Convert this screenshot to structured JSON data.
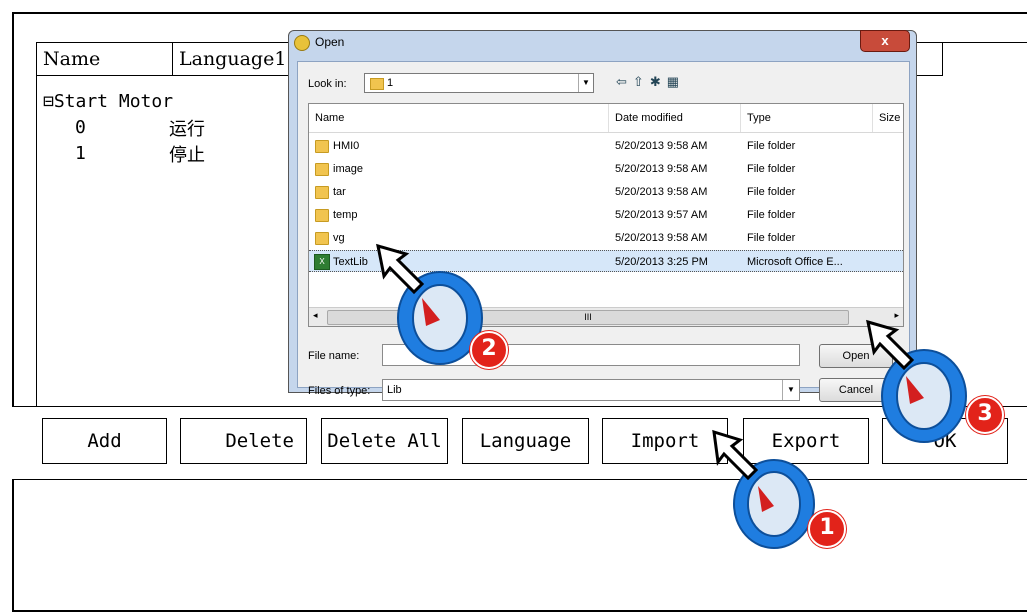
{
  "table": {
    "col_name": "Name",
    "col_language1": "Language1",
    "tree_root": "⊟Start Motor",
    "rows": [
      {
        "value": "0",
        "text": "运行"
      },
      {
        "value": "1",
        "text": "停止"
      }
    ]
  },
  "buttons": {
    "add": "Add",
    "delete": "Delete",
    "delete_all": "Delete All",
    "language": "Language",
    "import": "Import",
    "export": "Export",
    "ok": "OK"
  },
  "dialog": {
    "title": "Open",
    "close": "x",
    "look_in_label": "Look in:",
    "look_in_value": "1",
    "headers": {
      "name": "Name",
      "date": "Date modified",
      "type": "Type",
      "size": "Size"
    },
    "files": [
      {
        "name": "HMI0",
        "date": "5/20/2013 9:58 AM",
        "type": "File folder",
        "kind": "folder"
      },
      {
        "name": "image",
        "date": "5/20/2013 9:58 AM",
        "type": "File folder",
        "kind": "folder"
      },
      {
        "name": "tar",
        "date": "5/20/2013 9:58 AM",
        "type": "File folder",
        "kind": "folder"
      },
      {
        "name": "temp",
        "date": "5/20/2013 9:57 AM",
        "type": "File folder",
        "kind": "folder"
      },
      {
        "name": "vg",
        "date": "5/20/2013 9:58 AM",
        "type": "File folder",
        "kind": "folder"
      },
      {
        "name": "TextLib",
        "date": "5/20/2013 3:25 PM",
        "type": "Microsoft Office E...",
        "kind": "excel"
      }
    ],
    "scroll_grip": "III",
    "file_name_label": "File name:",
    "file_name_value": "",
    "files_of_type_label": "Files of type:",
    "files_of_type_value": "Lib",
    "open_button": "Open",
    "cancel_button": "Cancel"
  },
  "callouts": [
    "1",
    "2",
    "3"
  ],
  "colors": {
    "badge": "#e2231a",
    "mouse_ring": "#1f7de0"
  }
}
